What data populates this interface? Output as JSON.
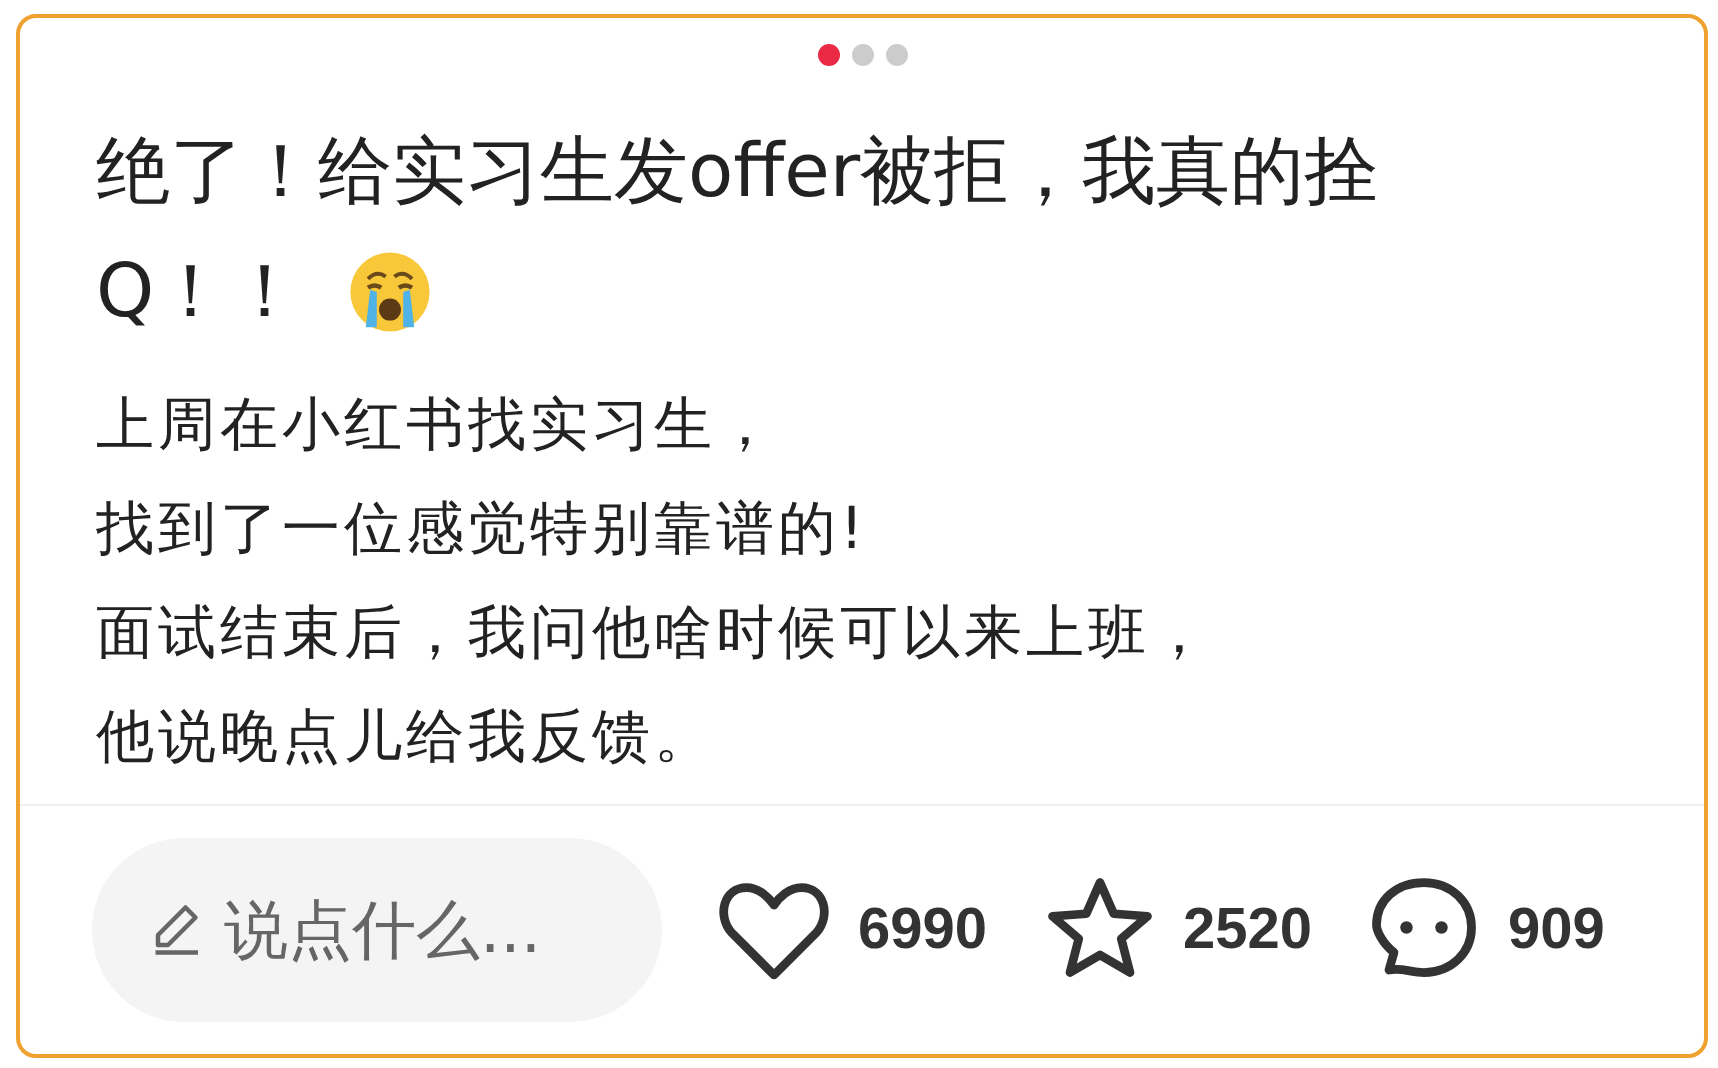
{
  "pager": {
    "dots": [
      {
        "selected": true
      },
      {
        "selected": false
      },
      {
        "selected": false
      }
    ]
  },
  "title_lines": [
    "绝了！给实习生发offer被拒，我真的拴",
    "Q！！"
  ],
  "body_lines": [
    "上周在小红书找实习生，",
    "找到了一位感觉特别靠谱的!",
    "面试结束后，我问他啥时候可以来上班，",
    "他说晚点儿给我反馈。"
  ],
  "comment": {
    "placeholder": "说点什么..."
  },
  "actions": [
    {
      "kind": "like",
      "count": "6990"
    },
    {
      "kind": "star",
      "count": "2520"
    },
    {
      "kind": "comment",
      "count": "909"
    }
  ]
}
